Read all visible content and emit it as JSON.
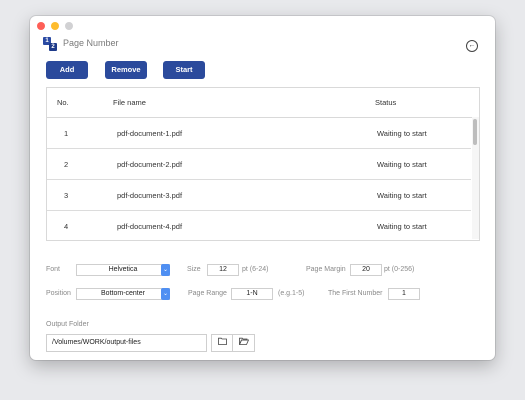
{
  "app": {
    "title": "Page Number",
    "icon_label_1": "1",
    "icon_label_2": "2"
  },
  "toolbar": {
    "add_label": "Add",
    "remove_label": "Remove",
    "start_label": "Start"
  },
  "table": {
    "headers": [
      "No.",
      "File name",
      "Status"
    ],
    "rows": [
      {
        "no": "1",
        "file": "pdf-document-1.pdf",
        "status": "Waiting to start"
      },
      {
        "no": "2",
        "file": "pdf-document-2.pdf",
        "status": "Waiting to start"
      },
      {
        "no": "3",
        "file": "pdf-document-3.pdf",
        "status": "Waiting to start"
      },
      {
        "no": "4",
        "file": "pdf-document-4.pdf",
        "status": "Waiting to start"
      }
    ]
  },
  "settings": {
    "font_label": "Font",
    "font_value": "Helvetica",
    "size_label": "Size",
    "size_value": "12",
    "size_hint": "pt (6-24)",
    "margin_label": "Page Margin",
    "margin_value": "20",
    "margin_hint": "pt (0-256)",
    "position_label": "Position",
    "position_value": "Bottom-center",
    "range_label": "Page Range",
    "range_value": "1-N",
    "range_hint": "(e.g.1-5)",
    "first_number_label": "The First Number",
    "first_number_value": "1"
  },
  "output": {
    "label": "Output Folder",
    "path": "/Volumes/WORK/output-files"
  },
  "icons": {
    "back": "back-arrow-icon",
    "folder": "folder-icon",
    "open_folder": "open-folder-icon",
    "dropdown": "chevron-down-icon"
  },
  "colors": {
    "accent": "#2b4a9c",
    "select_arrow": "#4f8ff2"
  }
}
